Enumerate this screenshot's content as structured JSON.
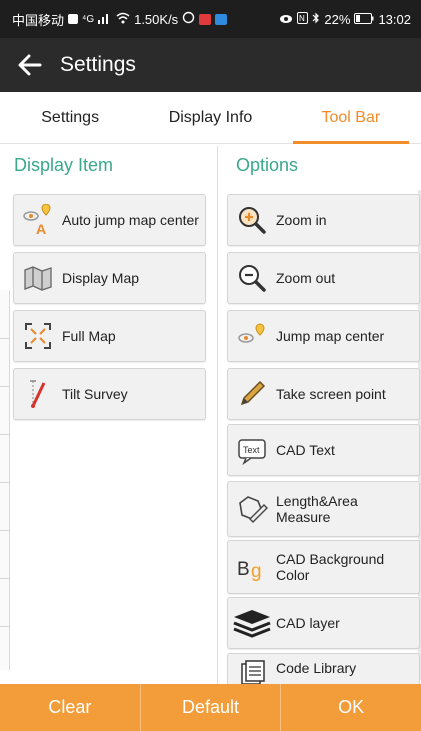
{
  "status_bar": {
    "carrier": "中国移动",
    "network": "⁴G",
    "speed": "1.50K/s",
    "battery": "22%",
    "time": "13:02"
  },
  "app_bar": {
    "title": "Settings"
  },
  "tabs": [
    {
      "label": "Settings"
    },
    {
      "label": "Display Info"
    },
    {
      "label": "Tool Bar"
    }
  ],
  "display_item": {
    "header": "Display Item",
    "items": [
      {
        "label": "Auto jump map center",
        "icon": "auto-jump-icon"
      },
      {
        "label": "Display Map",
        "icon": "map-icon"
      },
      {
        "label": "Full Map",
        "icon": "full-map-icon"
      },
      {
        "label": "Tilt Survey",
        "icon": "tilt-survey-icon"
      }
    ]
  },
  "options": {
    "header": "Options",
    "items": [
      {
        "label": "Zoom in",
        "icon": "zoom-in-icon"
      },
      {
        "label": "Zoom out",
        "icon": "zoom-out-icon"
      },
      {
        "label": "Jump map center",
        "icon": "jump-center-icon"
      },
      {
        "label": "Take screen point",
        "icon": "pencil-icon"
      },
      {
        "label": "CAD Text",
        "icon": "text-icon"
      },
      {
        "label": "Length&Area Measure",
        "icon": "measure-icon"
      },
      {
        "label": "CAD Background Color",
        "icon": "bg-color-icon"
      },
      {
        "label": "CAD layer",
        "icon": "layers-icon"
      },
      {
        "label": "Code Library",
        "icon": "code-library-icon"
      }
    ]
  },
  "footer": {
    "clear_label": "Clear",
    "default_label": "Default",
    "ok_label": "OK"
  },
  "colors": {
    "accent_orange": "#f08c2a",
    "header_green": "#3aa88c",
    "footer_bg": "#f39c3a"
  }
}
